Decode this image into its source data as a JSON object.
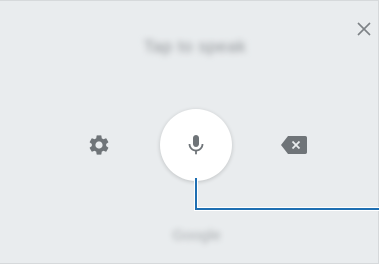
{
  "voice_panel": {
    "prompt": "Tap to speak",
    "brand": "Google",
    "icons": {
      "close": "close-icon",
      "settings": "gear-icon",
      "microphone": "microphone-icon",
      "backspace": "backspace-icon"
    },
    "colors": {
      "panel_background": "#e9ecee",
      "icon_gray": "#7d8286",
      "mic_button": "#ffffff",
      "callout_line": "#1f6fb2"
    }
  }
}
